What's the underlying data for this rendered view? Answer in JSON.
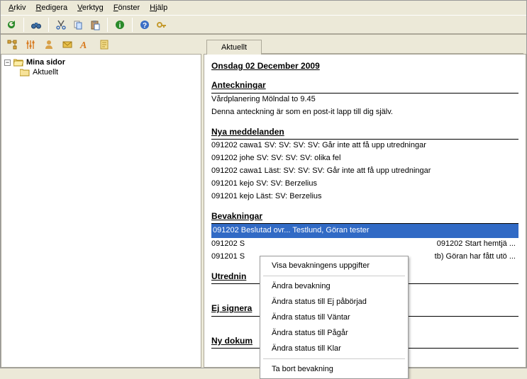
{
  "menu": {
    "arkiv": "Arkiv",
    "redigera": "Redigera",
    "verktyg": "Verktyg",
    "fonster": "Fönster",
    "hjalp": "Hjälp"
  },
  "tree": {
    "root": "Mina sidor",
    "child1": "Aktuellt"
  },
  "tab": {
    "aktuellt": "Aktuellt"
  },
  "page": {
    "title": "Onsdag 02 December 2009",
    "sect_anteckningar": "Anteckningar",
    "ant_1": "Vårdplanering Mölndal to 9.45",
    "ant_2": "Denna anteckning är som en post-it lapp till dig själv.",
    "sect_nya": "Nya meddelanden",
    "m1": "091202  cawa1  SV: SV: SV: SV: Går inte att få upp utredningar",
    "m2": "091202  johe  SV: SV: SV: SV: olika fel",
    "m3": "091202  cawa1  Läst: SV: SV: SV: Går inte att få upp utredningar",
    "m4": "091201  kejo  SV: SV: Berzelius",
    "m5": "091201  kejo  Läst: SV: Berzelius",
    "sect_bevakningar": "Bevakningar",
    "b1": "091202  Beslutad ovr... Testlund, Göran  tester",
    "b2a": "091202  S",
    "b2b": "091202 Start hemtjä ...",
    "b3a": "091201  S",
    "b3b": "tb)   Göran har fått utö ...",
    "sect_utred": "Utrednin",
    "sect_ej": "Ej signera",
    "sect_nydok": "Ny dokum"
  },
  "ctx": {
    "i1": "Visa bevakningens uppgifter",
    "i2": "Ändra bevakning",
    "i3": "Ändra status till Ej påbörjad",
    "i4": "Ändra status till Väntar",
    "i5": "Ändra status till Pågår",
    "i6": "Ändra status till Klar",
    "i7": "Ta bort bevakning"
  }
}
